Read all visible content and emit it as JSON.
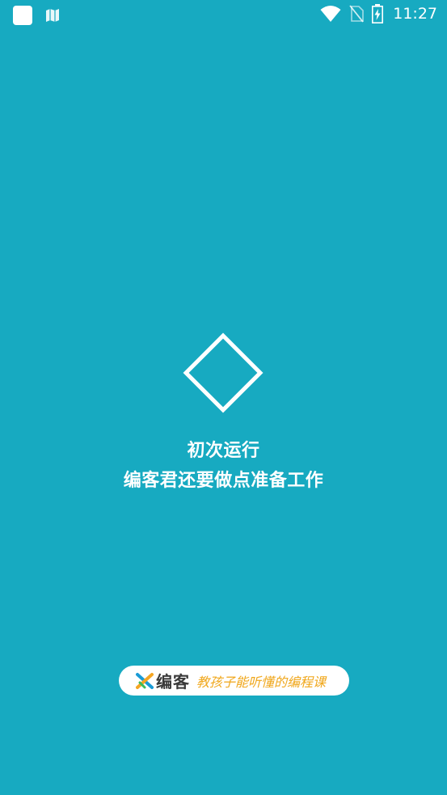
{
  "status_bar": {
    "time": "11:27",
    "icons": [
      "app-square-icon",
      "map-icon",
      "wifi-icon",
      "no-sim-icon",
      "battery-charging-icon"
    ]
  },
  "main": {
    "loader_icon": "diamond-outline-icon",
    "message_line1": "初次运行",
    "message_line2": "编客君还要做点准备工作"
  },
  "brand": {
    "logo_icon": "biankee-logo-icon",
    "name": "编客",
    "slogan": "教孩子能听懂的编程课"
  },
  "colors": {
    "background": "#17aac1",
    "text": "#ffffff",
    "slogan": "#f0a71b",
    "brand_name": "#3a3a3a"
  }
}
